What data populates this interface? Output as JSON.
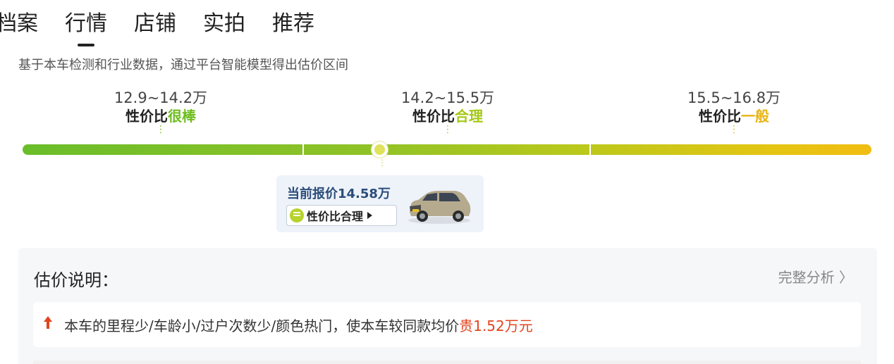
{
  "tabs": [
    {
      "label": "档案",
      "active": false
    },
    {
      "label": "行情",
      "active": true
    },
    {
      "label": "店铺",
      "active": false
    },
    {
      "label": "实拍",
      "active": false
    },
    {
      "label": "推荐",
      "active": false
    }
  ],
  "subtitle": "基于本车检测和行业数据，通过平台智能模型得出估价区间",
  "ranges": [
    {
      "price": "12.9~14.2万",
      "prefix": "性价比",
      "level": "很棒",
      "color": "#6dbd1f"
    },
    {
      "price": "14.2~15.5万",
      "prefix": "性价比",
      "level": "合理",
      "color": "#a3c814"
    },
    {
      "price": "15.5~16.8万",
      "prefix": "性价比",
      "level": "一般",
      "color": "#e7b412"
    }
  ],
  "current_quote": {
    "label": "当前报价14.58万",
    "badge_label": "性价比合理",
    "badge_icon": "smiley-face-icon",
    "car_image": "car-thumbnail"
  },
  "explanation": {
    "title": "估价说明：",
    "more_label": "完整分析 〉",
    "item_icon": "arrow-up-icon",
    "item_text": "本车的里程少/车龄小/过户次数少/颜色热门，使本车较同款均价",
    "item_emphasis": "贵1.52万元",
    "emphasis_color": "#e2441f"
  }
}
